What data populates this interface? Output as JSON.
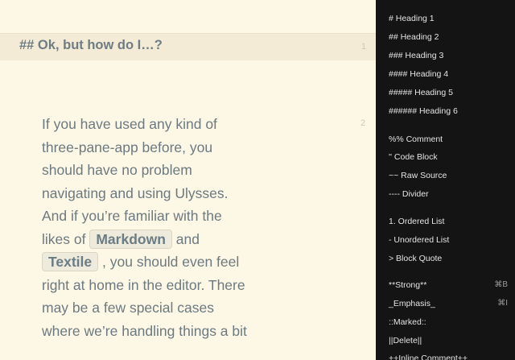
{
  "editor": {
    "heading_line": "## Ok, but how do I…?",
    "line_numbers": [
      "1",
      "2"
    ],
    "paragraph": {
      "l1": "If you have used any kind of",
      "l2": "three-pane-app before, you",
      "l3": "should have no problem",
      "l4": "navigating and using Ulysses.",
      "l5": "And if you’re familiar with the",
      "l6_pre": "likes of",
      "l6_tag": "Markdown",
      "l6_post": "and",
      "l7_tag": "Textile",
      "l7_post": ", you should even feel",
      "l8": "right at home in the editor. There",
      "l9": "may be a few special cases",
      "l10": "where we’re handling things a bit"
    }
  },
  "markup_sheet": {
    "items": [
      {
        "label": "# Heading 1",
        "shortcut": ""
      },
      {
        "label": "## Heading 2",
        "shortcut": ""
      },
      {
        "label": "### Heading 3",
        "shortcut": ""
      },
      {
        "label": "#### Heading 4",
        "shortcut": ""
      },
      {
        "label": "##### Heading 5",
        "shortcut": ""
      },
      {
        "label": "###### Heading 6",
        "shortcut": ""
      },
      {
        "label": "%% Comment",
        "shortcut": ""
      },
      {
        "label": "'' Code Block",
        "shortcut": ""
      },
      {
        "label": "~~ Raw Source",
        "shortcut": ""
      },
      {
        "label": "---- Divider",
        "shortcut": ""
      },
      {
        "label": "1. Ordered List",
        "shortcut": ""
      },
      {
        "label": "- Unordered List",
        "shortcut": ""
      },
      {
        "label": "> Block Quote",
        "shortcut": ""
      },
      {
        "label": "**Strong**",
        "shortcut": "⌘B"
      },
      {
        "label": "_Emphasis_",
        "shortcut": "⌘I"
      },
      {
        "label": "::Marked::",
        "shortcut": ""
      },
      {
        "label": "||Delete||",
        "shortcut": ""
      },
      {
        "label": "++Inline Comment++",
        "shortcut": ""
      }
    ]
  }
}
